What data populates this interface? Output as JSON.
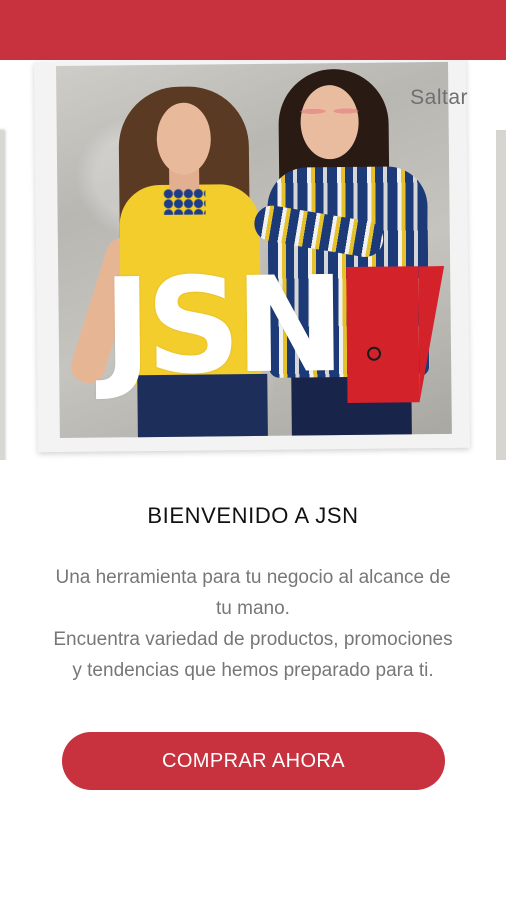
{
  "colors": {
    "brand_red": "#c7323e",
    "logo_red": "#d4222b",
    "text_dark": "#111111",
    "text_muted": "#777777"
  },
  "carousel": {
    "skip_label": "Saltar",
    "logo_text": "JSN",
    "slide_count": 4,
    "active_slide": 1
  },
  "welcome": {
    "title": "BIENVENIDO A JSN",
    "description_lines": [
      "Una herramienta para tu negocio al alcance de",
      "tu mano.",
      "Encuentra variedad de productos, promociones",
      "y tendencias que hemos preparado para ti."
    ]
  },
  "actions": {
    "buy_now_label": "COMPRAR AHORA"
  }
}
